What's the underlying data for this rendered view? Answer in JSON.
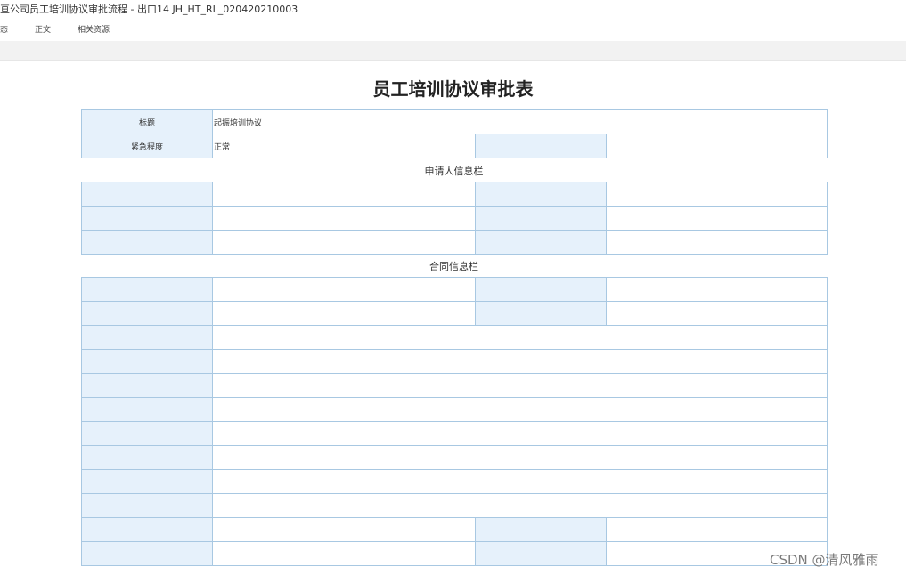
{
  "window": {
    "title": "亘公司员工培训协议审批流程 - 出口14 JH_HT_RL_020420210003"
  },
  "tabs": [
    {
      "label": "态"
    },
    {
      "label": "正文"
    },
    {
      "label": "相关资源"
    }
  ],
  "form": {
    "title": "员工培训协议审批表",
    "header_rows": [
      {
        "label": "标题",
        "value": "起振培训协议"
      },
      {
        "label": "紧急程度",
        "value": "正常"
      }
    ],
    "section_applicant": "申请人信息栏",
    "section_contract": "合同信息栏"
  },
  "watermark": "CSDN @清风雅雨",
  "colors": {
    "label_bg": "#e6f1fb",
    "border": "#a8c8e2",
    "toolbar_bg": "#f2f2f2"
  }
}
